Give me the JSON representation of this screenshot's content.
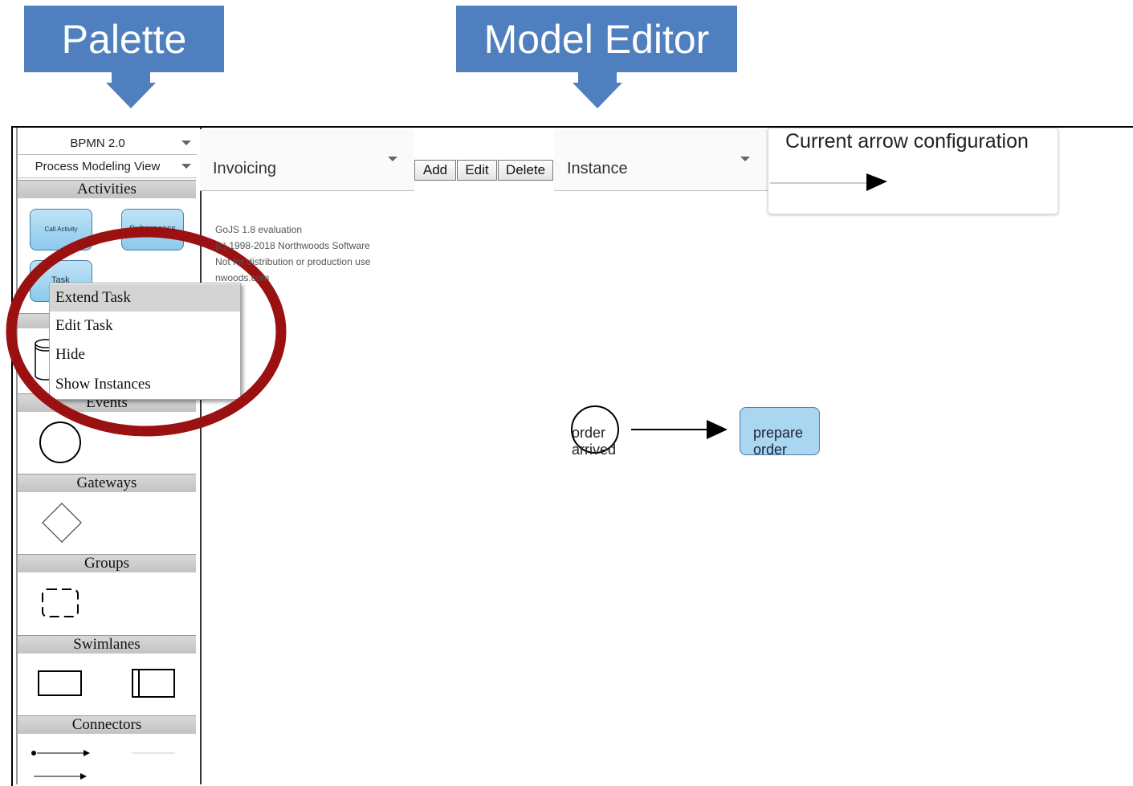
{
  "callouts": {
    "palette": "Palette",
    "model_editor": "Model Editor"
  },
  "palette": {
    "language_select": "BPMN 2.0",
    "view_select": "Process Modeling View",
    "sections": {
      "activities": "Activities",
      "events": "Events",
      "gateways": "Gateways",
      "groups": "Groups",
      "swimlanes": "Swimlanes",
      "connectors": "Connectors"
    },
    "activities": {
      "call_activity": "Call Activity",
      "subprocess": "Subprocess",
      "task": "Task"
    }
  },
  "context_menu": {
    "items": [
      "Extend Task",
      "Edit Task",
      "Hide",
      "Show Instances"
    ]
  },
  "toolbar": {
    "model_select": "Invoicing",
    "add_label": "Add",
    "edit_label": "Edit",
    "delete_label": "Delete",
    "instance_select": "Instance"
  },
  "arrow_config": {
    "title": "Current arrow configuration"
  },
  "watermark": {
    "line1": "GoJS 1.8 evaluation",
    "line2": "(c) 1998-2018 Northwoods Software",
    "line3": "Not for distribution or production use",
    "line4": "nwoods.com"
  },
  "diagram": {
    "start_event_label": "order arrived",
    "task_label": "prepare order"
  },
  "colors": {
    "callout_blue": "#4f7fbe",
    "highlight_red": "#9b1111",
    "task_fill": "#a9d6f1"
  }
}
